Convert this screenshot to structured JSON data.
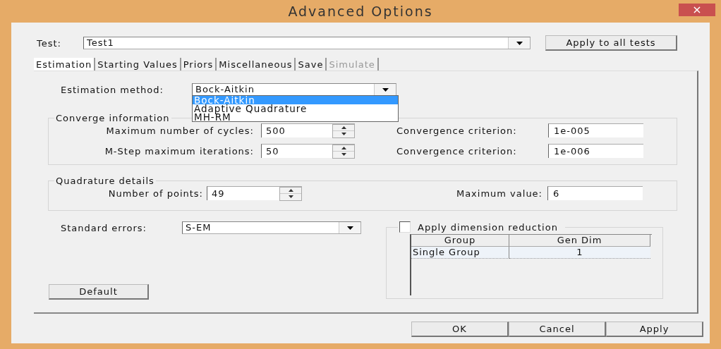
{
  "window": {
    "title": "Advanced Options",
    "close": "×"
  },
  "test": {
    "label": "Test:",
    "value": "Test1"
  },
  "apply_all_button": "Apply to all tests",
  "tabs": [
    {
      "label": "Estimation",
      "selected": true,
      "disabled": false
    },
    {
      "label": "Starting Values",
      "selected": false,
      "disabled": false
    },
    {
      "label": "Priors",
      "selected": false,
      "disabled": false
    },
    {
      "label": "Miscellaneous",
      "selected": false,
      "disabled": false
    },
    {
      "label": "Save",
      "selected": false,
      "disabled": false
    },
    {
      "label": "Simulate",
      "selected": false,
      "disabled": true
    }
  ],
  "estimation_method": {
    "label": "Estimation method:",
    "value": "Bock-Aitkin",
    "expanded": true,
    "options": [
      {
        "label": "Bock-Aitkin",
        "selected": true
      },
      {
        "label": "Adaptive Quadrature",
        "selected": false
      },
      {
        "label": "MH-RM",
        "selected": false
      }
    ]
  },
  "converge_information": {
    "title": "Converge information",
    "rows": [
      {
        "label": "Maximum number of cycles:",
        "value": "500",
        "criterion_label": "Convergence criterion:",
        "criterion_value": "1e-005"
      },
      {
        "label": "M-Step maximum iterations:",
        "value": "50",
        "criterion_label": "Convergence criterion:",
        "criterion_value": "1e-006"
      }
    ]
  },
  "quadrature_details": {
    "title": "Quadrature details",
    "points_label": "Number of points:",
    "points_value": "49",
    "max_label": "Maximum value:",
    "max_value": "6"
  },
  "standard_errors": {
    "label": "Standard errors:",
    "value": "S-EM"
  },
  "dimension_reduction": {
    "label": "Apply dimension reduction",
    "checked": false,
    "columns": [
      "Group",
      "Gen Dim"
    ],
    "rows": [
      {
        "cells": [
          "Single Group",
          "1"
        ]
      }
    ]
  },
  "default_button": "Default",
  "buttons": [
    "OK",
    "Cancel",
    "Apply"
  ]
}
